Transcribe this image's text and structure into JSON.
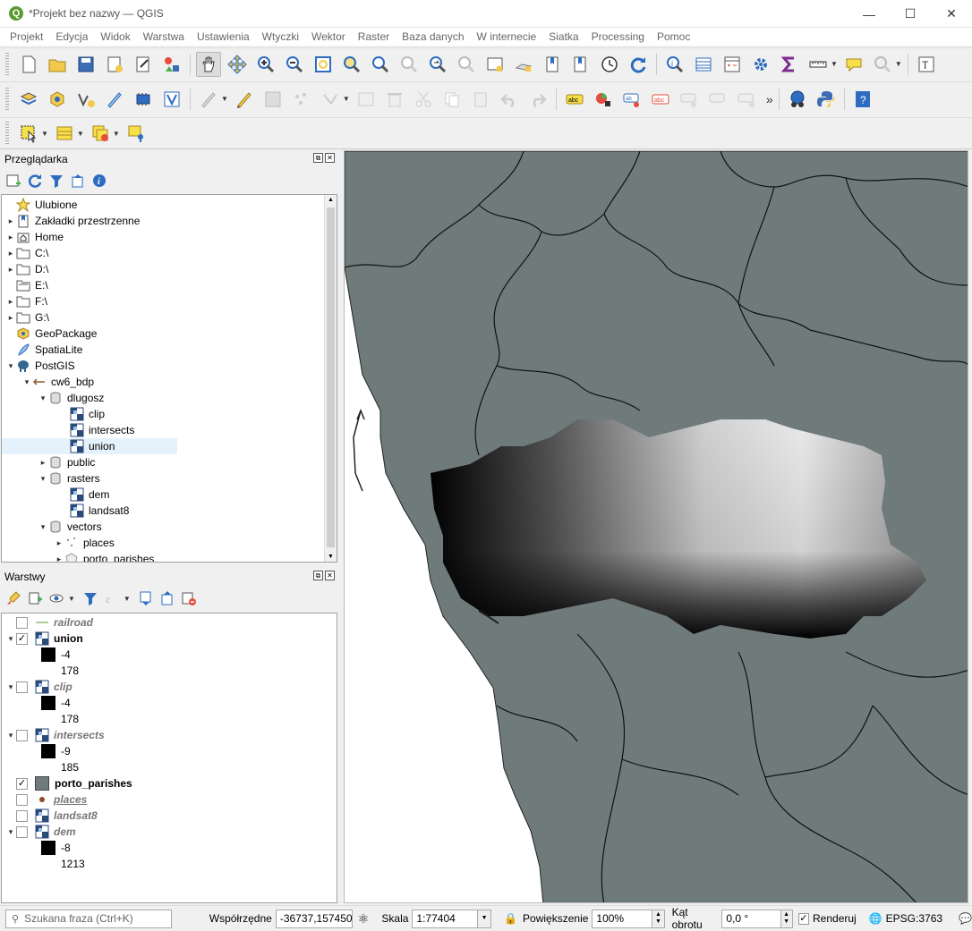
{
  "window": {
    "title": "*Projekt bez nazwy — QGIS",
    "logo_letter": "Q"
  },
  "menu": [
    "Projekt",
    "Edycja",
    "Widok",
    "Warstwa",
    "Ustawienia",
    "Wtyczki",
    "Wektor",
    "Raster",
    "Baza danych",
    "W internecie",
    "Siatka",
    "Processing",
    "Pomoc"
  ],
  "browser": {
    "title": "Przeglądarka",
    "items": [
      {
        "label": "Ulubione"
      },
      {
        "label": "Zakładki przestrzenne"
      },
      {
        "label": "Home"
      },
      {
        "label": "C:\\"
      },
      {
        "label": "D:\\"
      },
      {
        "label": "E:\\"
      },
      {
        "label": "F:\\"
      },
      {
        "label": "G:\\"
      },
      {
        "label": "GeoPackage"
      },
      {
        "label": "SpatiaLite"
      },
      {
        "label": "PostGIS"
      },
      {
        "label": "cw6_bdp"
      },
      {
        "label": "dlugosz"
      },
      {
        "label": "clip"
      },
      {
        "label": "intersects"
      },
      {
        "label": "union"
      },
      {
        "label": "public"
      },
      {
        "label": "rasters"
      },
      {
        "label": "dem"
      },
      {
        "label": "landsat8"
      },
      {
        "label": "vectors"
      },
      {
        "label": "places"
      },
      {
        "label": "porto_parishes"
      }
    ]
  },
  "layers": {
    "title": "Warstwy",
    "items": [
      {
        "name": "railroad"
      },
      {
        "name": "union",
        "min": "-4",
        "max": "178"
      },
      {
        "name": "clip",
        "min": "-4",
        "max": "178"
      },
      {
        "name": "intersects",
        "min": "-9",
        "max": "185"
      },
      {
        "name": "porto_parishes"
      },
      {
        "name": "places"
      },
      {
        "name": "landsat8"
      },
      {
        "name": "dem",
        "min": "-8",
        "max": "1213"
      }
    ]
  },
  "status": {
    "search_placeholder": "Szukana fraza (Ctrl+K)",
    "coord_label": "Współrzędne",
    "coord_value": "-36737,157450",
    "scale_label": "Skala",
    "scale_value": "1:77404",
    "zoom_label": "Powiększenie",
    "zoom_value": "100%",
    "rotation_label": "Kąt obrotu",
    "rotation_value": "0,0 °",
    "render_label": "Renderuj",
    "crs": "EPSG:3763"
  },
  "colors": {
    "parishes_fill": "#6f7b7b",
    "accent_toolbar": "#2d6cc0"
  }
}
